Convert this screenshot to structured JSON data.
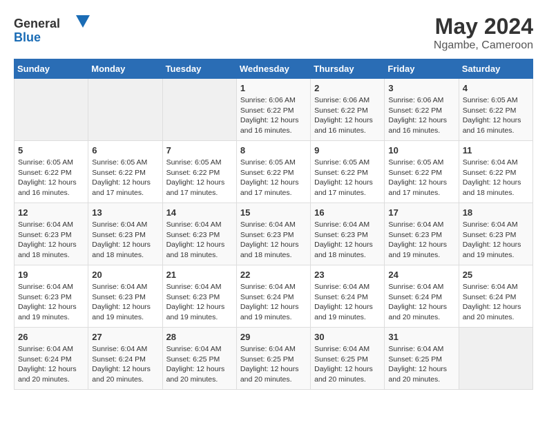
{
  "logo": {
    "text_general": "General",
    "text_blue": "Blue"
  },
  "title": "May 2024",
  "subtitle": "Ngambe, Cameroon",
  "days_of_week": [
    "Sunday",
    "Monday",
    "Tuesday",
    "Wednesday",
    "Thursday",
    "Friday",
    "Saturday"
  ],
  "weeks": [
    [
      {
        "day": "",
        "content": ""
      },
      {
        "day": "",
        "content": ""
      },
      {
        "day": "",
        "content": ""
      },
      {
        "day": "1",
        "content": "Sunrise: 6:06 AM\nSunset: 6:22 PM\nDaylight: 12 hours and 16 minutes."
      },
      {
        "day": "2",
        "content": "Sunrise: 6:06 AM\nSunset: 6:22 PM\nDaylight: 12 hours and 16 minutes."
      },
      {
        "day": "3",
        "content": "Sunrise: 6:06 AM\nSunset: 6:22 PM\nDaylight: 12 hours and 16 minutes."
      },
      {
        "day": "4",
        "content": "Sunrise: 6:05 AM\nSunset: 6:22 PM\nDaylight: 12 hours and 16 minutes."
      }
    ],
    [
      {
        "day": "5",
        "content": "Sunrise: 6:05 AM\nSunset: 6:22 PM\nDaylight: 12 hours and 16 minutes."
      },
      {
        "day": "6",
        "content": "Sunrise: 6:05 AM\nSunset: 6:22 PM\nDaylight: 12 hours and 17 minutes."
      },
      {
        "day": "7",
        "content": "Sunrise: 6:05 AM\nSunset: 6:22 PM\nDaylight: 12 hours and 17 minutes."
      },
      {
        "day": "8",
        "content": "Sunrise: 6:05 AM\nSunset: 6:22 PM\nDaylight: 12 hours and 17 minutes."
      },
      {
        "day": "9",
        "content": "Sunrise: 6:05 AM\nSunset: 6:22 PM\nDaylight: 12 hours and 17 minutes."
      },
      {
        "day": "10",
        "content": "Sunrise: 6:05 AM\nSunset: 6:22 PM\nDaylight: 12 hours and 17 minutes."
      },
      {
        "day": "11",
        "content": "Sunrise: 6:04 AM\nSunset: 6:22 PM\nDaylight: 12 hours and 18 minutes."
      }
    ],
    [
      {
        "day": "12",
        "content": "Sunrise: 6:04 AM\nSunset: 6:23 PM\nDaylight: 12 hours and 18 minutes."
      },
      {
        "day": "13",
        "content": "Sunrise: 6:04 AM\nSunset: 6:23 PM\nDaylight: 12 hours and 18 minutes."
      },
      {
        "day": "14",
        "content": "Sunrise: 6:04 AM\nSunset: 6:23 PM\nDaylight: 12 hours and 18 minutes."
      },
      {
        "day": "15",
        "content": "Sunrise: 6:04 AM\nSunset: 6:23 PM\nDaylight: 12 hours and 18 minutes."
      },
      {
        "day": "16",
        "content": "Sunrise: 6:04 AM\nSunset: 6:23 PM\nDaylight: 12 hours and 18 minutes."
      },
      {
        "day": "17",
        "content": "Sunrise: 6:04 AM\nSunset: 6:23 PM\nDaylight: 12 hours and 19 minutes."
      },
      {
        "day": "18",
        "content": "Sunrise: 6:04 AM\nSunset: 6:23 PM\nDaylight: 12 hours and 19 minutes."
      }
    ],
    [
      {
        "day": "19",
        "content": "Sunrise: 6:04 AM\nSunset: 6:23 PM\nDaylight: 12 hours and 19 minutes."
      },
      {
        "day": "20",
        "content": "Sunrise: 6:04 AM\nSunset: 6:23 PM\nDaylight: 12 hours and 19 minutes."
      },
      {
        "day": "21",
        "content": "Sunrise: 6:04 AM\nSunset: 6:23 PM\nDaylight: 12 hours and 19 minutes."
      },
      {
        "day": "22",
        "content": "Sunrise: 6:04 AM\nSunset: 6:24 PM\nDaylight: 12 hours and 19 minutes."
      },
      {
        "day": "23",
        "content": "Sunrise: 6:04 AM\nSunset: 6:24 PM\nDaylight: 12 hours and 19 minutes."
      },
      {
        "day": "24",
        "content": "Sunrise: 6:04 AM\nSunset: 6:24 PM\nDaylight: 12 hours and 20 minutes."
      },
      {
        "day": "25",
        "content": "Sunrise: 6:04 AM\nSunset: 6:24 PM\nDaylight: 12 hours and 20 minutes."
      }
    ],
    [
      {
        "day": "26",
        "content": "Sunrise: 6:04 AM\nSunset: 6:24 PM\nDaylight: 12 hours and 20 minutes."
      },
      {
        "day": "27",
        "content": "Sunrise: 6:04 AM\nSunset: 6:24 PM\nDaylight: 12 hours and 20 minutes."
      },
      {
        "day": "28",
        "content": "Sunrise: 6:04 AM\nSunset: 6:25 PM\nDaylight: 12 hours and 20 minutes."
      },
      {
        "day": "29",
        "content": "Sunrise: 6:04 AM\nSunset: 6:25 PM\nDaylight: 12 hours and 20 minutes."
      },
      {
        "day": "30",
        "content": "Sunrise: 6:04 AM\nSunset: 6:25 PM\nDaylight: 12 hours and 20 minutes."
      },
      {
        "day": "31",
        "content": "Sunrise: 6:04 AM\nSunset: 6:25 PM\nDaylight: 12 hours and 20 minutes."
      },
      {
        "day": "",
        "content": ""
      }
    ]
  ]
}
